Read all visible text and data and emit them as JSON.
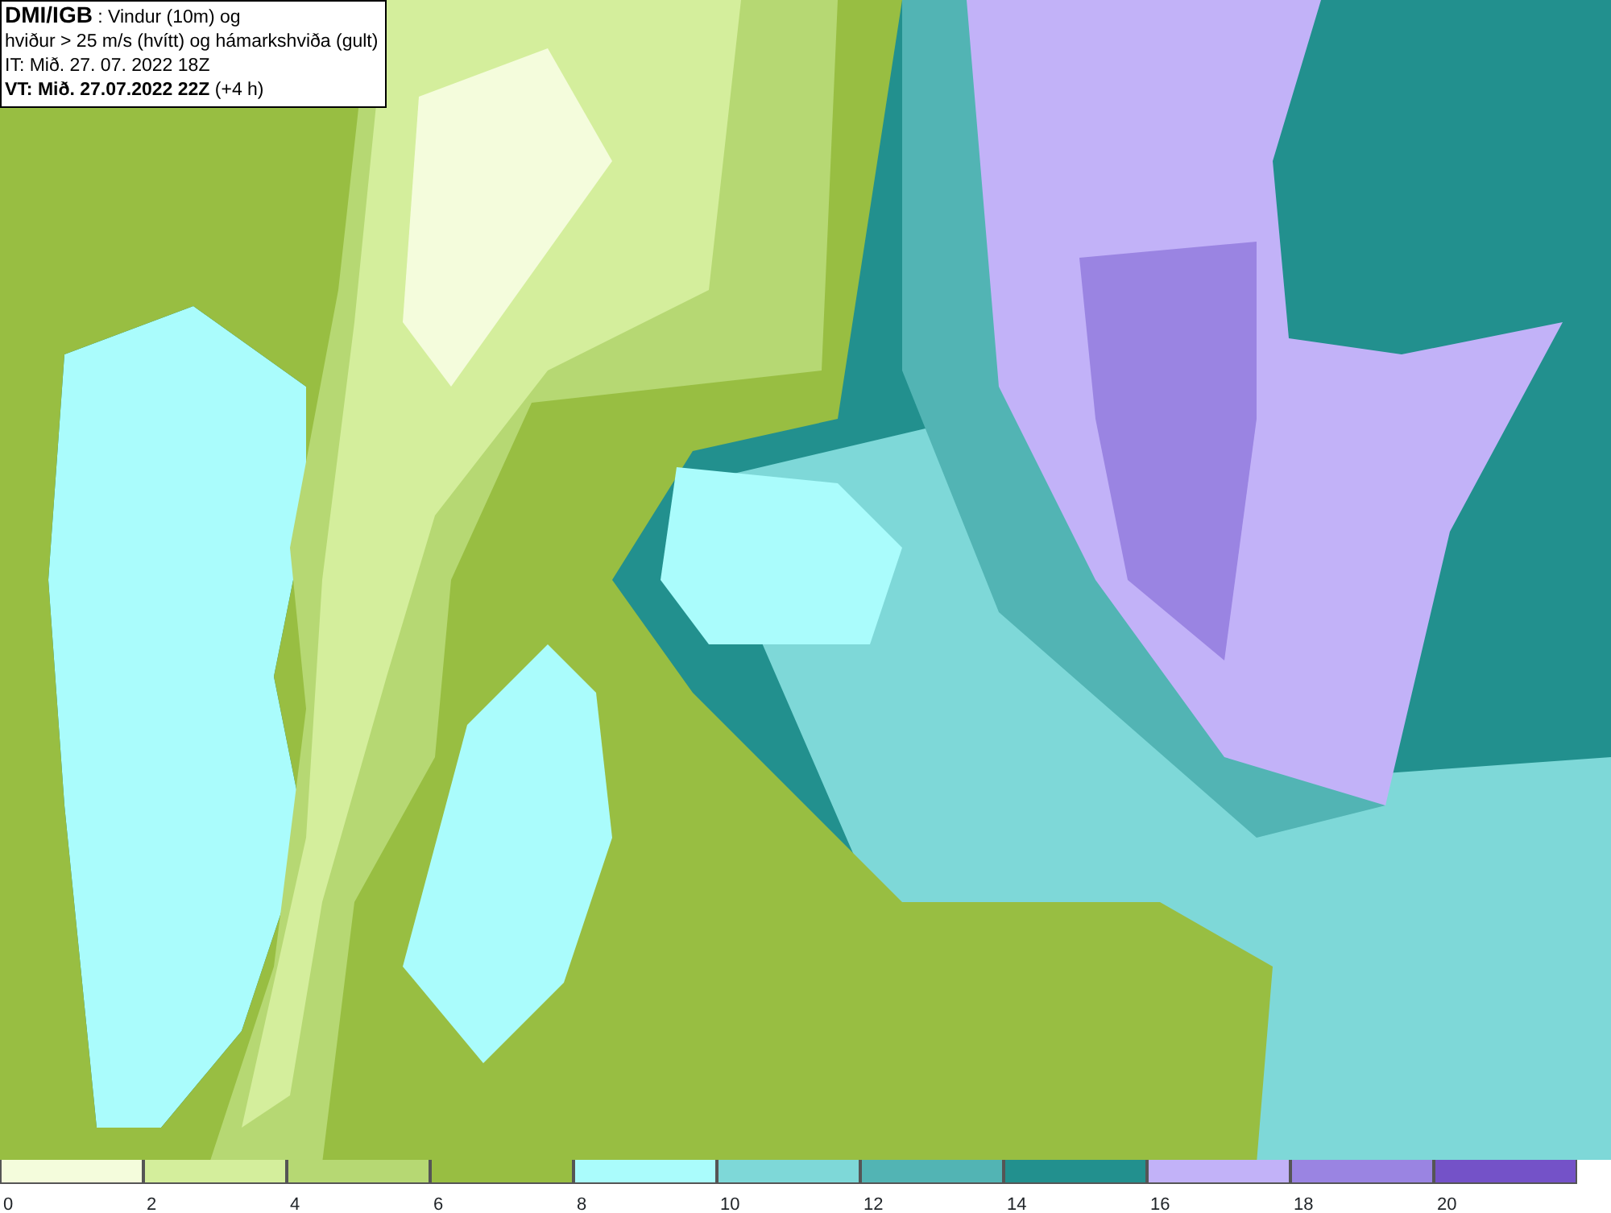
{
  "header": {
    "lines": [
      "**DMI/IGB** : Vindur (10m) og",
      "hviður > 25 m/s (hvítt) og hámarkshviða (gult)",
      "IT: Mið. 27. 07. 2022 18Z",
      "**VT: Mið. 27.07.2022 22Z** (+4 h)"
    ]
  },
  "legend": {
    "bins": [
      {
        "label": "0",
        "color": "#f4fcdc"
      },
      {
        "label": "2",
        "color": "#d4ee9c"
      },
      {
        "label": "4",
        "color": "#b6d873"
      },
      {
        "label": "6",
        "color": "#98be42"
      },
      {
        "label": "8",
        "color": "#aafcfc"
      },
      {
        "label": "10",
        "color": "#7ed8d8"
      },
      {
        "label": "12",
        "color": "#52b4b4"
      },
      {
        "label": "14",
        "color": "#22908e"
      },
      {
        "label": "16",
        "color": "#c2b2f8"
      },
      {
        "label": "18",
        "color": "#9a84e2"
      },
      {
        "label": "20",
        "color": "#7452c8"
      }
    ]
  }
}
